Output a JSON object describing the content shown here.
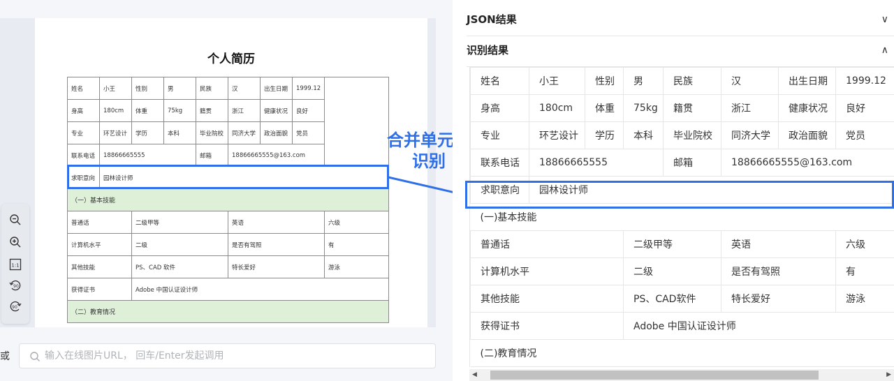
{
  "preview": {
    "title": "个人简历",
    "rows": [
      [
        "姓名",
        "小王",
        "性别",
        "男",
        "民族",
        "汉",
        "出生日期",
        "1999.12"
      ],
      [
        "身高",
        "180cm",
        "体重",
        "75kg",
        "籍贯",
        "浙江",
        "健康状况",
        "良好"
      ],
      [
        "专业",
        "环艺设计",
        "学历",
        "本科",
        "毕业院校",
        "同济大学",
        "政治面貌",
        "党员"
      ],
      [
        "联系电话",
        "18866665555",
        "邮箱",
        "18866665555@163.com"
      ],
      [
        "求职意向",
        "园林设计师"
      ],
      [
        "（一）基本技能"
      ],
      [
        "普通话",
        "二级甲等",
        "英语",
        "六级"
      ],
      [
        "计算机水平",
        "二级",
        "是否有驾照",
        "有"
      ],
      [
        "其他技能",
        "PS、CAD 软件",
        "特长爱好",
        "游泳"
      ],
      [
        "获得证书",
        "Adobe 中国认证设计师"
      ],
      [
        "（二）教育情况"
      ]
    ]
  },
  "zoom_controls": {
    "zoom_out": "zoom-out",
    "zoom_in": "zoom-in",
    "reset": "1:1",
    "rotate_left": "90",
    "rotate_right": "90"
  },
  "url_input": {
    "prefix": "或",
    "placeholder": "输入在线图片URL， 回车/Enter发起调用"
  },
  "callout": {
    "line1": "合并单元格",
    "line2": "识别"
  },
  "result_panel": {
    "json_section": "JSON结果",
    "recognize_section": "识别结果",
    "rows": [
      [
        "姓名",
        "小王",
        "性别",
        "男",
        "民族",
        "汉",
        "出生日期",
        "1999.12"
      ],
      [
        "身高",
        "180cm",
        "体重",
        "75kg",
        "籍贯",
        "浙江",
        "健康状况",
        "良好"
      ],
      [
        "专业",
        "环艺设计",
        "学历",
        "本科",
        "毕业院校",
        "同济大学",
        "政治面貌",
        "党员"
      ],
      [
        "联系电话",
        "18866665555",
        "邮箱",
        "18866665555@163.com"
      ],
      [
        "求职意向",
        "园林设计师"
      ],
      [
        "(一)基本技能"
      ],
      [
        "普通话",
        "二级甲等",
        "英语",
        "六级"
      ],
      [
        "计算机水平",
        "二级",
        "是否有驾照",
        "有"
      ],
      [
        "其他技能",
        "PS、CAD软件",
        "特长爱好",
        "游泳"
      ],
      [
        "获得证书",
        "Adobe 中国认证设计师"
      ],
      [
        "(二)教育情况"
      ]
    ]
  },
  "colors": {
    "accent": "#2f6fe8",
    "section_fill": "#dff0d8"
  }
}
